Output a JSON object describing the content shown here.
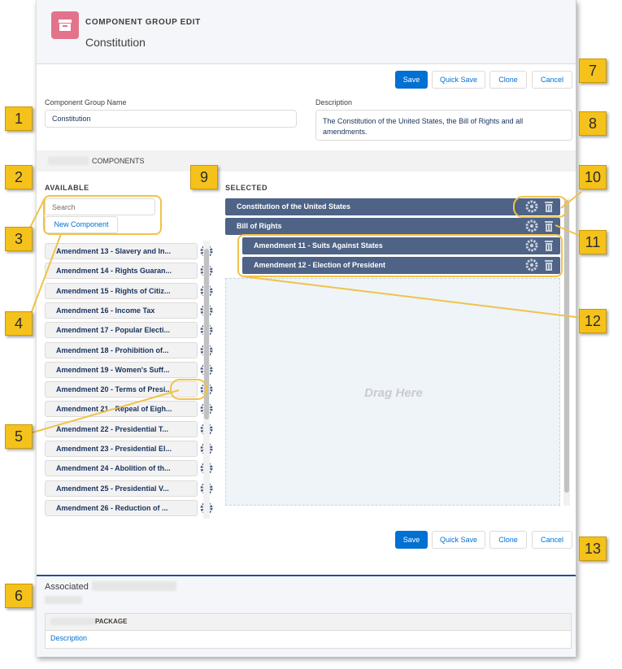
{
  "header": {
    "subtitle": "COMPONENT GROUP EDIT",
    "title": "Constitution"
  },
  "buttons": {
    "save": "Save",
    "quick_save": "Quick Save",
    "clone": "Clone",
    "cancel": "Cancel"
  },
  "form": {
    "name_label": "Component Group Name",
    "name_value": "Constitution",
    "description_label": "Description",
    "description_value": "The Constitution of the United States, the Bill of Rights and all amendments."
  },
  "components_section": {
    "title": "COMPONENTS"
  },
  "available": {
    "heading": "AVAILABLE",
    "search_placeholder": "Search",
    "new_component": "New Component",
    "items": [
      "Amendment 13 - Slavery and In...",
      "Amendment 14 - Rights Guaran...",
      "Amendment 15 - Rights of Citiz...",
      "Amendment 16 - Income Tax",
      "Amendment 17 - Popular Electi...",
      "Amendment 18 - Prohibition of...",
      "Amendment 19 - Women's Suff...",
      "Amendment 20 - Terms of Presi...",
      "Amendment 21 - Repeal of Eigh...",
      "Amendment 22 - Presidential T...",
      "Amendment 23 - Presidential El...",
      "Amendment 24 - Abolition of th...",
      "Amendment 25 - Presidential V...",
      "Amendment 26 - Reduction of ..."
    ]
  },
  "selected": {
    "heading": "SELECTED",
    "items": [
      "Constitution of the United States",
      "Bill of Rights",
      "Amendment 11 - Suits Against States",
      "Amendment 12 - Election of President"
    ],
    "drop_hint": "Drag Here"
  },
  "associated": {
    "title": "Associated",
    "package_header": "PACKAGE",
    "description_link": "Description"
  },
  "callouts": [
    "1",
    "2",
    "3",
    "4",
    "5",
    "6",
    "7",
    "8",
    "9",
    "10",
    "11",
    "12",
    "13"
  ],
  "colors": {
    "brand": "#0070d2",
    "selected_bg": "#4e6386",
    "callout": "#f5c21b",
    "icon_bg": "#e3738b"
  }
}
